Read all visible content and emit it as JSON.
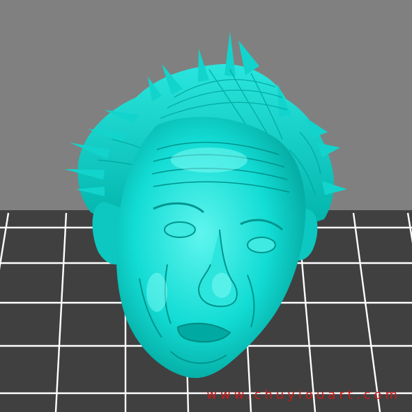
{
  "viewport": {
    "background_color": "#808080",
    "bed_color": "#404040",
    "grid_line_color": "#ffffff",
    "model_color": "#00e0d8",
    "model_shade_color": "#00a8a0",
    "model_highlight_color": "#7ffff6"
  },
  "model": {
    "label": "",
    "icon": "sculpted-head-model"
  },
  "watermark": {
    "text": "www.chuyiouart.com",
    "color": "#d01818"
  }
}
